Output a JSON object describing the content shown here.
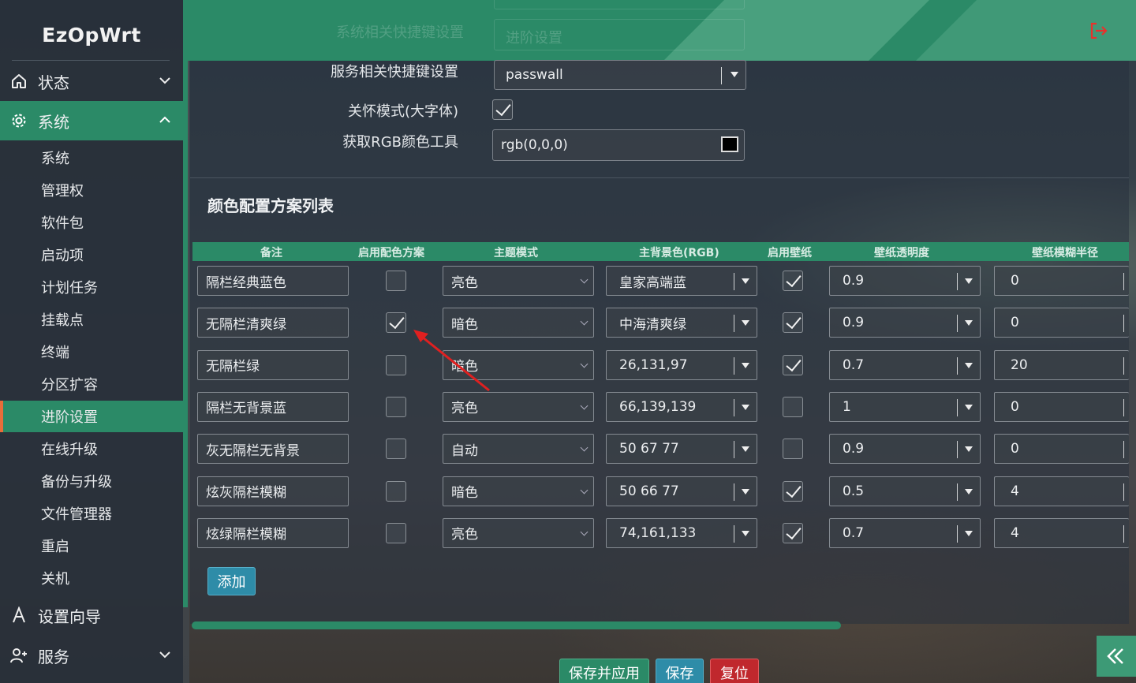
{
  "app": {
    "logo": "EzOpWrt"
  },
  "sidebar": {
    "top_items": [
      {
        "label": "状态",
        "icon": "home-icon"
      },
      {
        "label": "系统",
        "icon": "gear-icon"
      }
    ],
    "sub_items": [
      "系统",
      "管理权",
      "软件包",
      "启动项",
      "计划任务",
      "挂载点",
      "终端",
      "分区扩容",
      "进阶设置",
      "在线升级",
      "备份与升级",
      "文件管理器",
      "重启",
      "关机"
    ],
    "bottom_items": [
      {
        "label": "设置向导",
        "icon": "wizard-icon"
      },
      {
        "label": "服务",
        "icon": "user-plus-icon"
      }
    ],
    "active_sub": "进阶设置"
  },
  "header": {
    "ghost_label": "系统相关快捷键设置",
    "ghost_value": "进阶设置",
    "logout_icon": "logout-icon"
  },
  "form": {
    "service_shortcut_label": "服务相关快捷键设置",
    "service_shortcut_value": "passwall",
    "care_mode_label": "关怀模式(大字体)",
    "care_mode_checked": true,
    "rgb_tool_label": "获取RGB颜色工具",
    "rgb_tool_value": "rgb(0,0,0)",
    "rgb_swatch_color": "#000000"
  },
  "scheme_table": {
    "title": "颜色配置方案列表",
    "headers": [
      "备注",
      "启用配色方案",
      "主题模式",
      "主背景色(RGB)",
      "启用壁纸",
      "壁纸透明度",
      "壁纸模糊半径"
    ],
    "rows": [
      {
        "note": "隔栏经典蓝色",
        "enabled": false,
        "mode": "亮色",
        "bg": "皇家高端蓝",
        "wallpaper": true,
        "opacity": "0.9",
        "blur": "0"
      },
      {
        "note": "无隔栏清爽绿",
        "enabled": true,
        "mode": "暗色",
        "bg": "中海清爽绿",
        "wallpaper": true,
        "opacity": "0.9",
        "blur": "0"
      },
      {
        "note": "无隔栏绿",
        "enabled": false,
        "mode": "暗色",
        "bg": "26,131,97",
        "wallpaper": true,
        "opacity": "0.7",
        "blur": "20"
      },
      {
        "note": "隔栏无背景蓝",
        "enabled": false,
        "mode": "亮色",
        "bg": "66,139,139",
        "wallpaper": false,
        "opacity": "1",
        "blur": "0"
      },
      {
        "note": "灰无隔栏无背景",
        "enabled": false,
        "mode": "自动",
        "bg": "50 67 77",
        "wallpaper": false,
        "opacity": "0.9",
        "blur": "0"
      },
      {
        "note": "炫灰隔栏模糊",
        "enabled": false,
        "mode": "暗色",
        "bg": "50 66 77",
        "wallpaper": true,
        "opacity": "0.5",
        "blur": "4"
      },
      {
        "note": "炫绿隔栏模糊",
        "enabled": false,
        "mode": "亮色",
        "bg": "74,161,133",
        "wallpaper": true,
        "opacity": "0.7",
        "blur": "4"
      }
    ],
    "add_label": "添加"
  },
  "actions": {
    "save_apply": "保存并应用",
    "save": "保存",
    "reset": "复位"
  },
  "colors": {
    "accent": "#2b8a67",
    "active_marker": "#e96d3a",
    "add_button": "#2e8ca8",
    "save_button": "#2e8ca8",
    "reset_button": "#c0282d",
    "annotation_arrow": "#e02020"
  }
}
